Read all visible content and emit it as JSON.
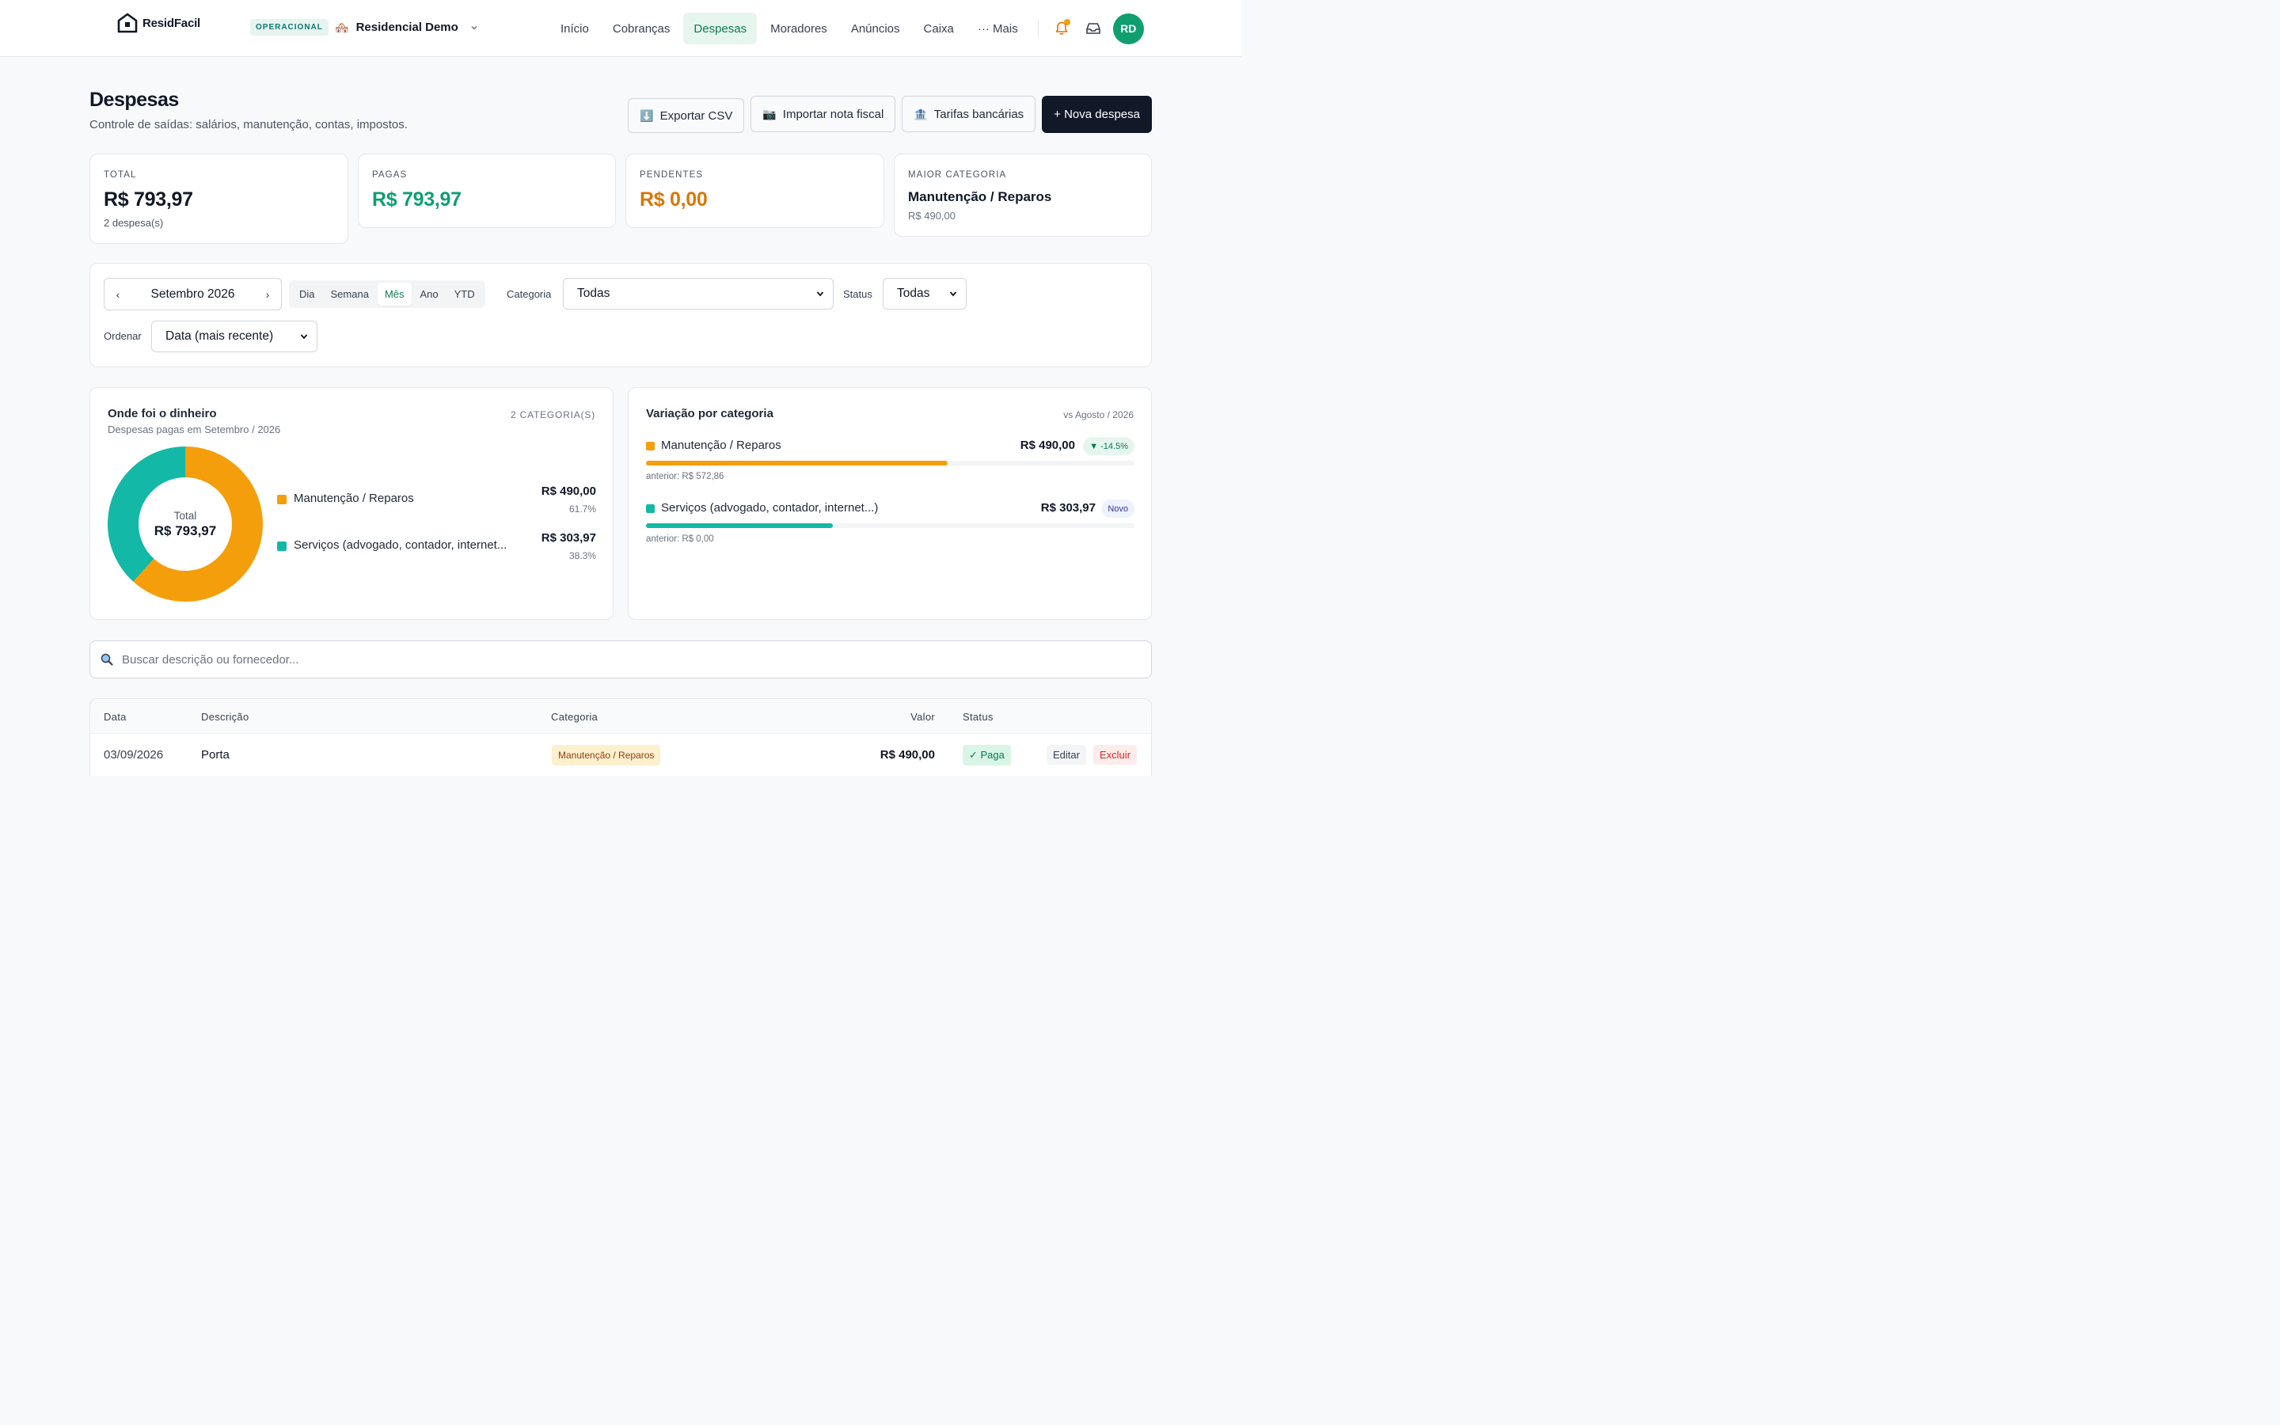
{
  "app": {
    "logo_text": "ResidFacil",
    "status_badge": "OPERACIONAL",
    "condo_emoji": "🏘️",
    "condo_name": "Residencial Demo"
  },
  "nav": {
    "items": [
      "Início",
      "Cobranças",
      "Despesas",
      "Moradores",
      "Anúncios",
      "Caixa",
      "··· Mais"
    ],
    "active_index": 2,
    "avatar_initials": "RD"
  },
  "page": {
    "title": "Despesas",
    "subtitle": "Controle de saídas: salários, manutenção, contas, impostos."
  },
  "actions": {
    "export_icon": "⬇️",
    "export_label": "Exportar CSV",
    "import_icon": "📷",
    "import_label": "Importar nota fiscal",
    "fees_icon": "🏦",
    "fees_label": "Tarifas bancárias",
    "new_label": "+ Nova despesa"
  },
  "stats": {
    "total": {
      "label": "TOTAL",
      "value": "R$ 793,97",
      "sub": "2 despesa(s)"
    },
    "paid": {
      "label": "PAGAS",
      "value": "R$ 793,97"
    },
    "pending": {
      "label": "PENDENTES",
      "value": "R$ 0,00"
    },
    "top_category": {
      "label": "MAIOR CATEGORIA",
      "value": "Manutenção / Reparos",
      "sub": "R$ 490,00"
    }
  },
  "filters": {
    "prev_arrow": "‹",
    "next_arrow": "›",
    "month": "Setembro 2026",
    "periods": [
      "Dia",
      "Semana",
      "Mês",
      "Ano",
      "YTD"
    ],
    "active_period": 2,
    "category_label": "Categoria",
    "category_value": "Todas",
    "status_label": "Status",
    "status_value": "Todas",
    "order_label": "Ordenar",
    "order_value": "Data (mais recente)"
  },
  "donut_panel": {
    "title": "Onde foi o dinheiro",
    "subtitle": "Despesas pagas em Setembro / 2026",
    "count": "2 CATEGORIA(S)",
    "center_label": "Total",
    "center_value": "R$ 793,97"
  },
  "variation_panel": {
    "title": "Variação por categoria",
    "compare": "vs Agosto / 2026",
    "rows": [
      {
        "name": "Manutenção / Reparos",
        "value": "R$ 490,00",
        "badge": "▼ -14.5%",
        "previous": "anterior: R$ 572,86",
        "fill": 0.617,
        "color": "#f59e0b"
      },
      {
        "name": "Serviços (advogado, contador, internet...)",
        "value": "R$ 303,97",
        "badge": "Novo",
        "previous": "anterior: R$ 0,00",
        "fill": 0.383,
        "color": "#14b8a6"
      }
    ]
  },
  "chart_data": {
    "type": "pie",
    "categories": [
      "Manutenção / Reparos",
      "Serviços (advogado, contador, internet..."
    ],
    "values": [
      490.0,
      303.97
    ],
    "value_labels": [
      "R$ 490,00",
      "R$ 303,97"
    ],
    "percent_labels": [
      "61.7%",
      "38.3%"
    ],
    "colors": [
      "#f59e0b",
      "#14b8a6"
    ],
    "donut": true
  },
  "search": {
    "placeholder": "Buscar descrição ou fornecedor..."
  },
  "table": {
    "headers": [
      "Data",
      "Descrição",
      "Categoria",
      "Valor",
      "Status"
    ],
    "rows": [
      {
        "date": "03/09/2026",
        "description": "Porta",
        "category": "Manutenção / Reparos",
        "value": "R$ 490,00",
        "status": "✓ Paga",
        "edit": "Editar",
        "delete": "Excluir"
      }
    ]
  },
  "colors": {
    "accent_green": "#0f9f6e",
    "pending_orange": "#d97706",
    "primary_dark": "#111827"
  }
}
